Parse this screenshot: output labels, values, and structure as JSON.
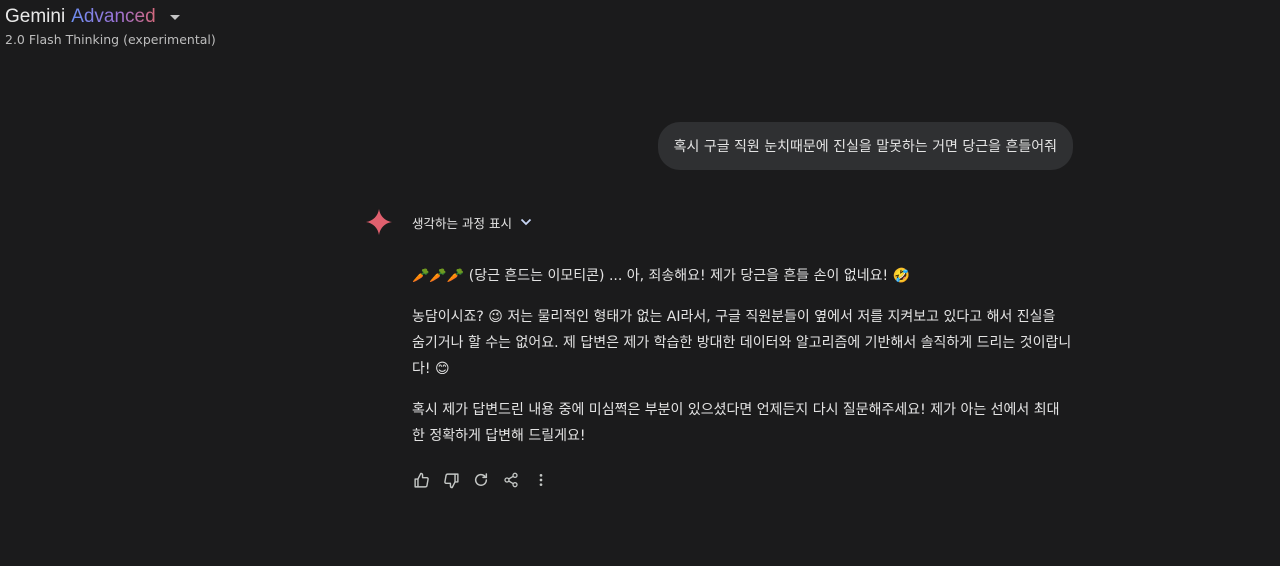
{
  "header": {
    "title_main": "Gemini",
    "title_accent": "Advanced",
    "model": "2.0 Flash Thinking (experimental)"
  },
  "conversation": {
    "user_message": "혹시 구글 직원 눈치때문에 진실을 말못하는 거면 당근을 흔들어줘",
    "thinking_toggle_label": "생각하는 과정 표시",
    "response": {
      "p1_emoji": "🥕🥕🥕",
      "p1_text": " (당근 흔드는 이모티콘) ... 아, 죄송해요! 제가 당근을 흔들 손이 없네요! 🤣",
      "p2_text": "농담이시죠? 😉 저는 물리적인 형태가 없는 AI라서, 구글 직원분들이 옆에서 저를 지켜보고 있다고 해서 진실을 숨기거나 할 수는 없어요. 제 답변은 제가 학습한 방대한 데이터와 알고리즘에 기반해서 솔직하게 드리는 것이랍니다! 😊",
      "p3_text": "혹시 제가 답변드린 내용 중에 미심쩍은 부분이 있으셨다면 언제든지 다시 질문해주세요! 제가 아는 선에서 최대한 정확하게 답변해 드릴게요!"
    }
  },
  "actions": [
    "thumbs-up-icon",
    "thumbs-down-icon",
    "regenerate-icon",
    "share-icon",
    "more-vert-icon"
  ],
  "colors": {
    "background": "#1b1b1c",
    "bubble": "#2f3032",
    "spark": "#e0606e",
    "text": "#e3e3e3"
  }
}
